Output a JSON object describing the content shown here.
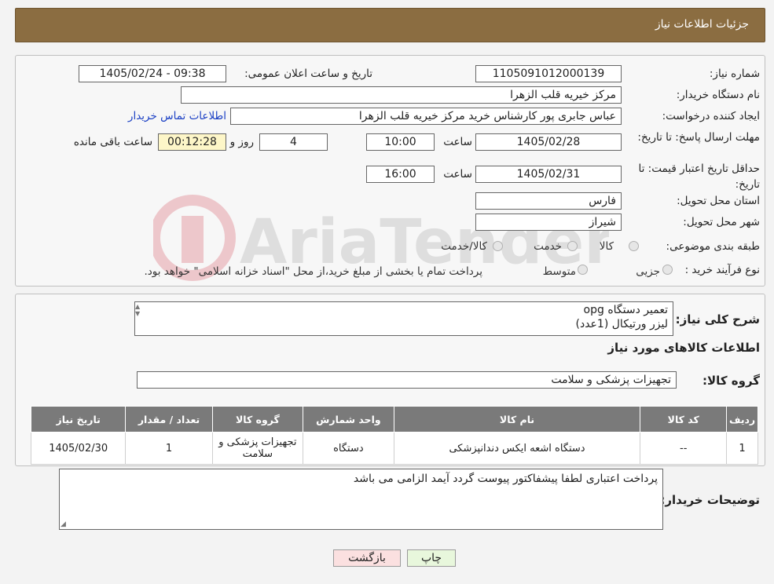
{
  "header": {
    "title": "جزئیات اطلاعات نیاز"
  },
  "fields": {
    "need_number_label": "شماره نیاز:",
    "need_number": "1105091012000139",
    "announce_label": "تاریخ و ساعت اعلان عمومی:",
    "announce_value": "1405/02/24 - 09:38",
    "buyer_org_label": "نام دستگاه خریدار:",
    "buyer_org": "مرکز خیریه قلب الزهرا",
    "creator_label": "ایجاد کننده درخواست:",
    "creator": "عباس جابری پور کارشناس خرید مرکز خیریه قلب الزهرا",
    "contact_link": "اطلاعات تماس خریدار",
    "deadline_label": "مهلت ارسال پاسخ: تا تاریخ:",
    "deadline_date": "1405/02/28",
    "time_label": "ساعت",
    "deadline_time": "10:00",
    "days": "4",
    "days_label": "روز و",
    "remaining": "00:12:28",
    "remaining_label": "ساعت باقی مانده",
    "validity_label": "حداقل تاریخ اعتبار قیمت: تا تاریخ:",
    "validity_date": "1405/02/31",
    "validity_time": "16:00",
    "province_label": "استان محل تحویل:",
    "province": "فارس",
    "city_label": "شهر محل تحویل:",
    "city": "شیراز",
    "category_label": "طبقه بندی موضوعی:",
    "cat_options": [
      "کالا",
      "خدمت",
      "کالا/خدمت"
    ],
    "process_label": "نوع فرآیند خرید :",
    "process_options": [
      "جزیی",
      "متوسط"
    ],
    "process_note": "پرداخت تمام یا بخشی از مبلغ خرید،از محل \"اسناد خزانه اسلامی\" خواهد بود."
  },
  "desc": {
    "label": "شرح کلی نیاز:",
    "line1": "تعمیر دستگاه opg",
    "line2": "لیزر ورتیکال    (1عدد)",
    "goods_info": "اطلاعات کالاهای مورد نیاز",
    "group_label": "گروه کالا:",
    "group_value": "تجهیزات پزشکی و سلامت"
  },
  "table": {
    "headers": [
      "ردیف",
      "کد کالا",
      "نام کالا",
      "واحد شمارش",
      "گروه کالا",
      "تعداد / مقدار",
      "تاریخ نیاز"
    ],
    "rows": [
      [
        "1",
        "--",
        "دستگاه اشعه ایکس دندانپزشکی",
        "دستگاه",
        "تجهیزات پزشکی و سلامت",
        "1",
        "1405/02/30"
      ]
    ]
  },
  "notes": {
    "label": "توضیحات خریدار:",
    "text": "پرداخت اعتباری لطفا پیشفاکتور پیوست گردد آیمد  الزامی می باشد"
  },
  "buttons": {
    "print": "چاپ",
    "back": "بازگشت"
  },
  "watermark": {
    "text": "AriaTender.neT"
  }
}
